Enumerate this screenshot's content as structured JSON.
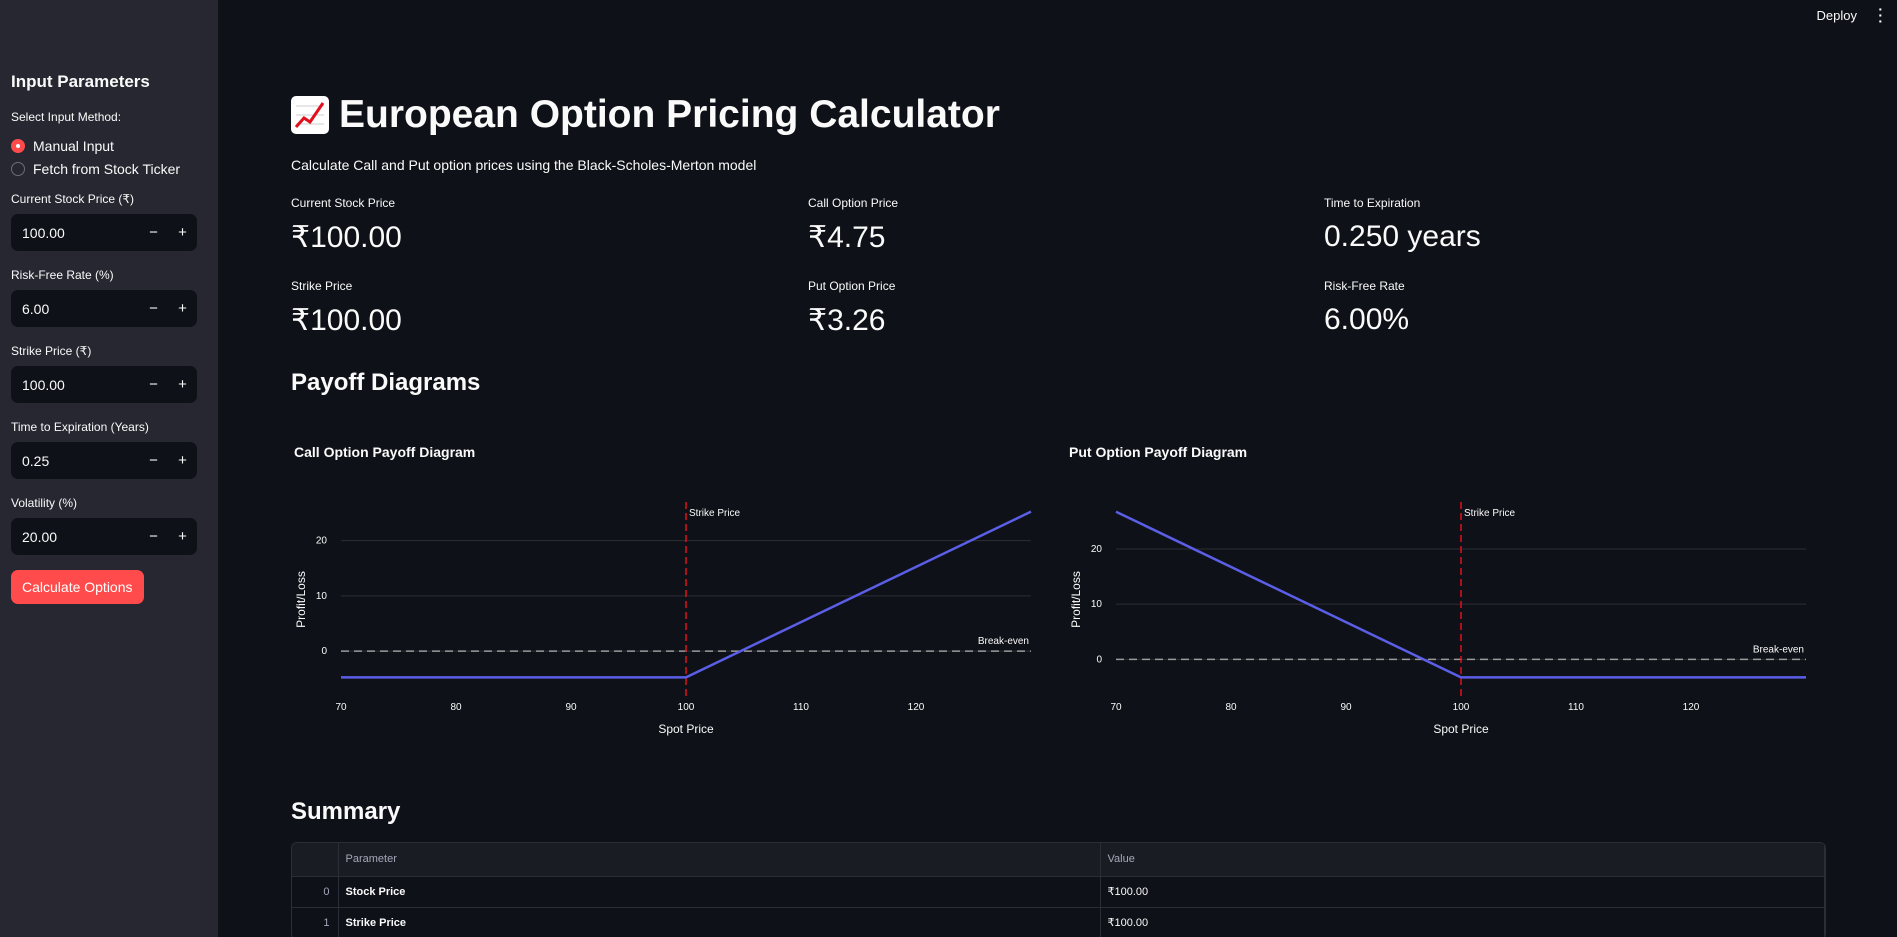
{
  "topbar": {
    "deploy_label": "Deploy",
    "menu_icon": "kebab-menu-icon"
  },
  "sidebar": {
    "title": "Input Parameters",
    "method_label": "Select Input Method:",
    "methods": [
      {
        "label": "Manual Input",
        "selected": true
      },
      {
        "label": "Fetch from Stock Ticker",
        "selected": false
      }
    ],
    "fields": [
      {
        "label": "Current Stock Price (₹)",
        "value": "100.00"
      },
      {
        "label": "Risk-Free Rate (%)",
        "value": "6.00"
      },
      {
        "label": "Strike Price (₹)",
        "value": "100.00"
      },
      {
        "label": "Time to Expiration (Years)",
        "value": "0.25"
      },
      {
        "label": "Volatility (%)",
        "value": "20.00"
      }
    ],
    "minus": "−",
    "plus": "+",
    "calculate_label": "Calculate Options"
  },
  "main": {
    "title": "European Option Pricing Calculator",
    "subtitle": "Calculate Call and Put option prices using the Black-Scholes-Merton model",
    "metrics": [
      {
        "label": "Current Stock Price",
        "value": "₹100.00"
      },
      {
        "label": "Call Option Price",
        "value": "₹4.75"
      },
      {
        "label": "Time to Expiration",
        "value": "0.250 years"
      },
      {
        "label": "Strike Price",
        "value": "₹100.00"
      },
      {
        "label": "Put Option Price",
        "value": "₹3.26"
      },
      {
        "label": "Risk-Free Rate",
        "value": "6.00%"
      }
    ],
    "payoff_heading": "Payoff Diagrams",
    "summary_heading": "Summary"
  },
  "chart_data": [
    {
      "type": "line",
      "title": "Call Option Payoff Diagram",
      "xlabel": "Spot Price",
      "ylabel": "Profit/Loss",
      "xlim": [
        70,
        130
      ],
      "ylim": [
        -6.5,
        27
      ],
      "xticks": [
        70,
        80,
        90,
        100,
        110,
        120
      ],
      "yticks": [
        0,
        10,
        20
      ],
      "series": [
        {
          "x": [
            70,
            100,
            130
          ],
          "y": [
            -4.75,
            -4.75,
            25.25
          ],
          "color": "#5b5ee6"
        }
      ],
      "annotations": [
        {
          "type": "vline",
          "x": 100,
          "label": "Strike Price",
          "color": "#e0101c"
        },
        {
          "type": "hline",
          "y": 0,
          "label": "Break-even",
          "color": "#9a9a9a"
        }
      ],
      "grid": true
    },
    {
      "type": "line",
      "title": "Put Option Payoff Diagram",
      "xlabel": "Spot Price",
      "ylabel": "Profit/Loss",
      "xlim": [
        70,
        130
      ],
      "ylim": [
        -5,
        28.5
      ],
      "xticks": [
        70,
        80,
        90,
        100,
        110,
        120
      ],
      "yticks": [
        0,
        10,
        20
      ],
      "series": [
        {
          "x": [
            70,
            100,
            130
          ],
          "y": [
            26.74,
            -3.26,
            -3.26
          ],
          "color": "#5b5ee6"
        }
      ],
      "annotations": [
        {
          "type": "vline",
          "x": 100,
          "label": "Strike Price",
          "color": "#e0101c"
        },
        {
          "type": "hline",
          "y": 0,
          "label": "Break-even",
          "color": "#9a9a9a"
        }
      ],
      "grid": true
    }
  ],
  "summary_table": {
    "columns": [
      "",
      "Parameter",
      "Value"
    ],
    "rows": [
      {
        "index": "0",
        "parameter": "Stock Price",
        "value": "₹100.00"
      },
      {
        "index": "1",
        "parameter": "Strike Price",
        "value": "₹100.00"
      }
    ]
  }
}
